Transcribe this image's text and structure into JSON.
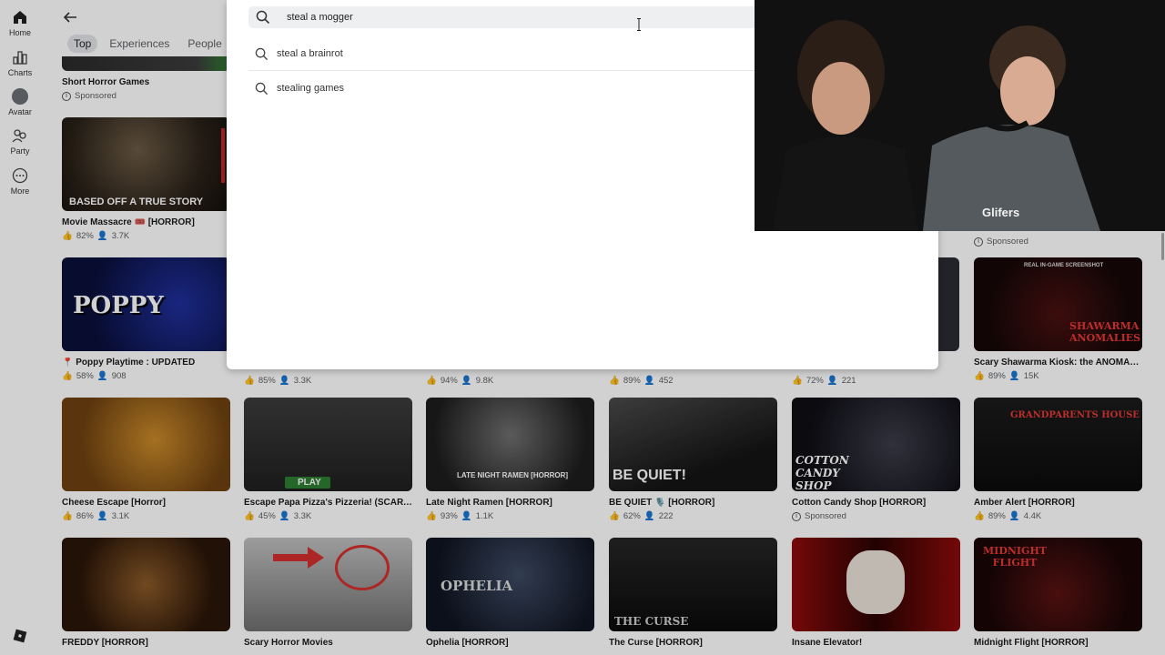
{
  "sidebar": {
    "items": [
      {
        "label": "Home",
        "icon": "home-icon"
      },
      {
        "label": "Charts",
        "icon": "charts-icon"
      },
      {
        "label": "Avatar",
        "icon": "avatar-icon"
      },
      {
        "label": "Party",
        "icon": "party-icon"
      },
      {
        "label": "More",
        "icon": "more-icon"
      }
    ]
  },
  "tabs": [
    {
      "label": "Top",
      "active": true
    },
    {
      "label": "Experiences",
      "active": false
    },
    {
      "label": "People",
      "active": false
    }
  ],
  "search": {
    "value": "steal a mogger",
    "suggestions": [
      "steal a brainrot",
      "stealing games"
    ]
  },
  "sponsored_label": "Sponsored",
  "games": {
    "row0": [
      {
        "title": "Short Horror Games",
        "sponsored": true
      }
    ],
    "row1": [
      {
        "title": "Movie Massacre 🎟️ [HORROR]",
        "rating": "82%",
        "players": "3.7K",
        "thumb_text": "BASED OFF A TRUE STORY"
      }
    ],
    "row1_right": {
      "sponsored": true
    },
    "row2": [
      {
        "title": "📍 Poppy Playtime : UPDATED",
        "rating": "58%",
        "players": "908",
        "thumb_text": "POPPY"
      },
      {
        "title": "",
        "rating": "85%",
        "players": "3.3K"
      },
      {
        "title": "",
        "rating": "94%",
        "players": "9.8K"
      },
      {
        "title": "",
        "rating": "89%",
        "players": "452"
      },
      {
        "title": "",
        "rating": "72%",
        "players": "221"
      },
      {
        "title": "Scary Shawarma Kiosk: the ANOMALY ...",
        "rating": "89%",
        "players": "15K",
        "thumb_text": "SHAWARMA ANOMALIES",
        "thumb_top": "REAL IN-GAME SCREENSHOT"
      }
    ],
    "row3": [
      {
        "title": "Cheese Escape [Horror]",
        "rating": "86%",
        "players": "3.1K"
      },
      {
        "title": "Escape Papa Pizza's Pizzeria! (SCARY ...",
        "rating": "45%",
        "players": "3.3K",
        "thumb_text": "PLAY"
      },
      {
        "title": "Late Night Ramen [HORROR]",
        "rating": "93%",
        "players": "1.1K",
        "thumb_text": "LATE NIGHT RAMEN [HORROR]"
      },
      {
        "title": "BE QUIET 🎙️ [HORROR]",
        "rating": "62%",
        "players": "222",
        "thumb_text": "BE QUIET!"
      },
      {
        "title": "Cotton Candy Shop [HORROR]",
        "sponsored": true,
        "thumb_text": "COTTON CANDY SHOP"
      },
      {
        "title": "Amber Alert [HORROR]",
        "rating": "89%",
        "players": "4.4K",
        "thumb_text": "GRANDPARENTS HOUSE"
      }
    ],
    "row4": [
      {
        "title": "FREDDY [HORROR]"
      },
      {
        "title": "Scary Horror Movies"
      },
      {
        "title": "Ophelia [HORROR]",
        "thumb_text": "OPHELIA"
      },
      {
        "title": "The Curse [HORROR]",
        "thumb_text": "THE CURSE"
      },
      {
        "title": "Insane Elevator!"
      },
      {
        "title": "Midnight Flight [HORROR]",
        "thumb_text": "MIDNIGHT FLIGHT"
      }
    ]
  },
  "webcam": {
    "shirt_text": "Glifers"
  }
}
